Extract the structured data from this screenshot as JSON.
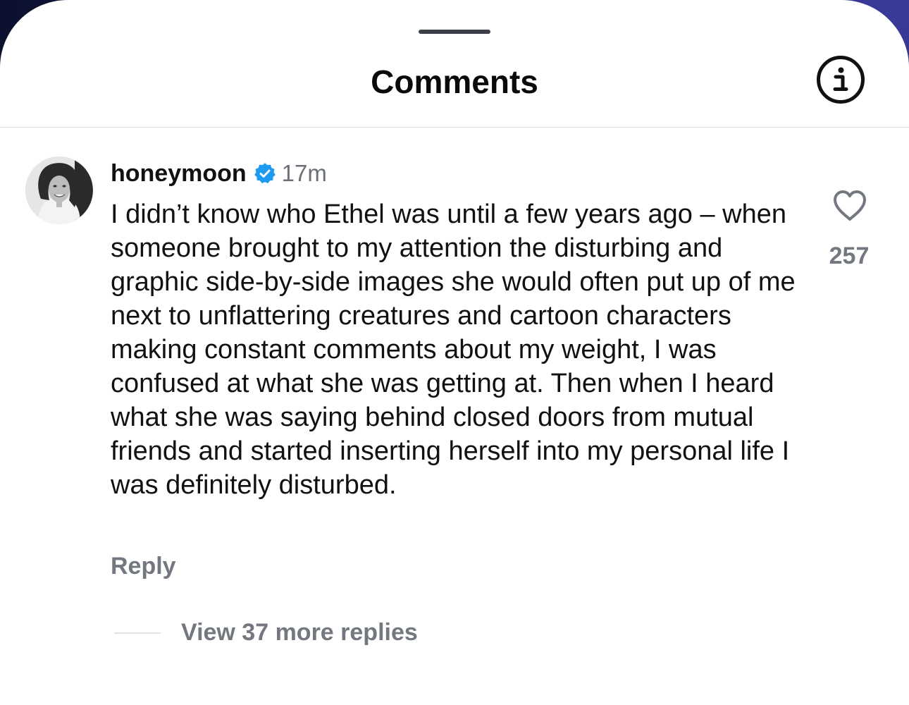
{
  "header": {
    "title": "Comments"
  },
  "icons": {
    "info": "info-icon",
    "verified": "verified-badge-icon",
    "like": "heart-icon"
  },
  "colors": {
    "verified_blue": "#1d9bf0",
    "secondary_text": "#737780",
    "primary_text": "#111111"
  },
  "comment": {
    "username": "honeymoon",
    "verified": true,
    "time": "17m",
    "text": "I didn’t know who Ethel was until a few years ago – when someone brought to my attention the disturbing and graphic side-by-side images she would often put up of me next to unflattering creatures and cartoon characters making constant comments about my weight, I was confused at what she was getting at. Then when I heard what she was saying behind closed doors from mutual friends and started inserting herself into my personal life I was definitely disturbed.",
    "likes": "257",
    "reply_label": "Reply",
    "view_replies_label": "View 37 more replies"
  }
}
